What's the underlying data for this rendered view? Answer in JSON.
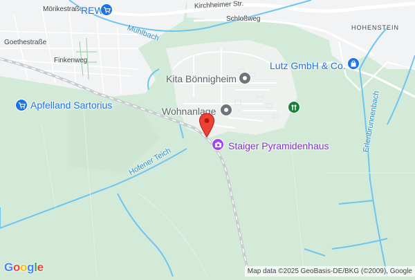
{
  "streets": {
    "moerikestrasse": "Mörikestraße",
    "goethestrasse": "Goethestraße",
    "finkenweg": "Finkenweg",
    "kirchheimer_str": "Kirchheimer Str.",
    "schlossweg": "Schloßweg"
  },
  "places": {
    "hohenstein": "HOHENSTEIN"
  },
  "waterways": {
    "muehlbach": "Mühlbach",
    "hofener_teich": "Hofener Teich",
    "erlenbrunnenbach": "Erlenbrunnenbach"
  },
  "pois": {
    "rewe": {
      "label": "REWE",
      "icon": "shopping-cart-icon"
    },
    "apfelland": {
      "label": "Apfelland Sartorius",
      "icon": "shopping-cart-icon"
    },
    "kita": {
      "label": "Kita Bönnigheim",
      "icon": "place-dot-icon"
    },
    "wohnanlage": {
      "label": "Wohnanlage",
      "icon": "place-dot-icon"
    },
    "lutz": {
      "label": "Lutz GmbH & Co.",
      "icon": "shopping-bag-icon"
    },
    "staiger": {
      "label": "Staiger Pyramidenhaus",
      "icon": "camera-icon"
    },
    "park": {
      "label": "",
      "icon": "park-icon"
    }
  },
  "attribution": "Map data ©2025 GeoBasis-DE/BKG (©2009), Google",
  "logo": {
    "letters": [
      "G",
      "o",
      "o",
      "g",
      "l",
      "e"
    ]
  },
  "colors": {
    "forest": "#d4ead9",
    "urban": "#f1f3f4",
    "road": "#ffffff",
    "rail": "#c8cbcf",
    "water": "#6dc5f2",
    "poi_blue": "#1a73e8",
    "poi_grey": "#70757a",
    "poi_purple": "#a142f4",
    "park_green": "#188038",
    "marker_red": "#ea4335"
  }
}
